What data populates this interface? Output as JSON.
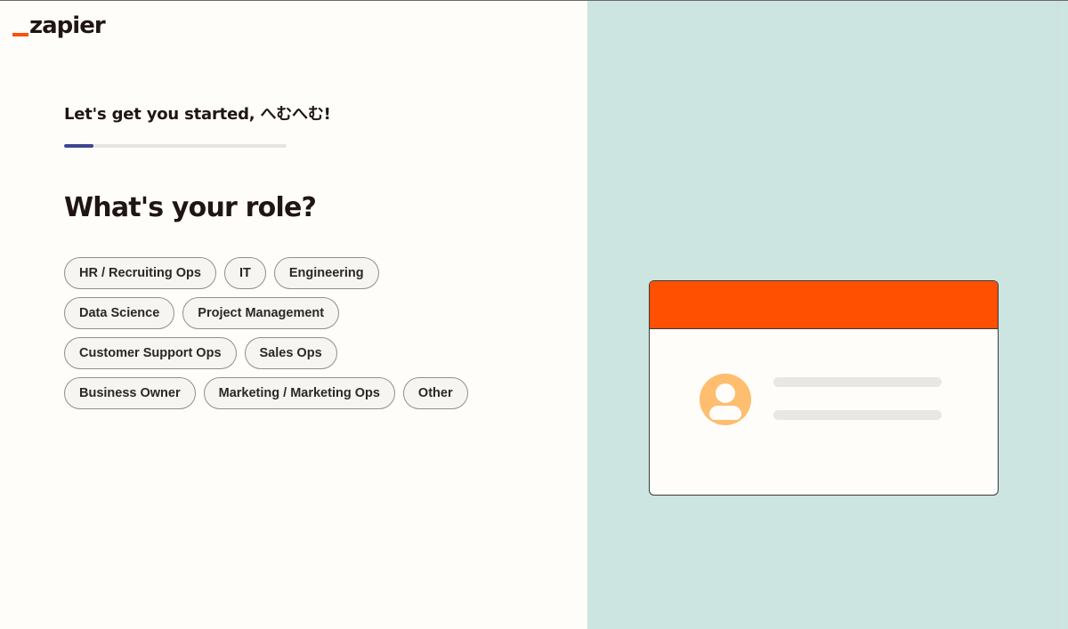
{
  "brand": {
    "name": "zapier",
    "accent_color": "#ff4f00"
  },
  "onboarding": {
    "greeting": "Let's get you started, へむへむ!",
    "progress_fraction": 0.13,
    "progress_color": "#3d4592",
    "question": "What's your role?"
  },
  "roles": [
    [
      "HR / Recruiting Ops",
      "IT",
      "Engineering"
    ],
    [
      "Data Science",
      "Project Management"
    ],
    [
      "Customer Support Ops",
      "Sales Ops"
    ],
    [
      "Business Owner",
      "Marketing / Marketing Ops",
      "Other"
    ]
  ],
  "illustration": {
    "panel_color": "#cce5e1",
    "header_color": "#ff4f00",
    "avatar_color": "#ffbd6f",
    "icon": "user-avatar-icon"
  }
}
